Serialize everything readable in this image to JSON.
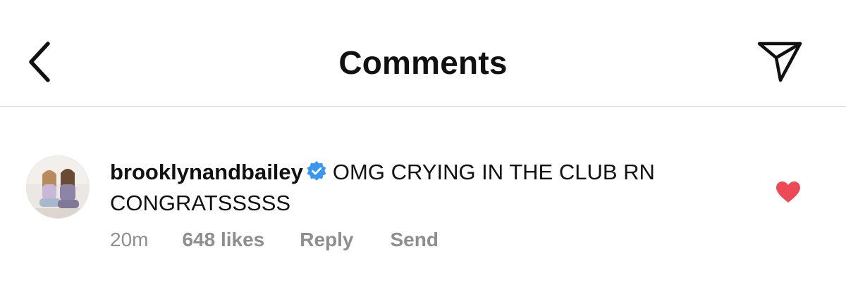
{
  "header": {
    "title": "Comments",
    "back_icon": "chevron-left-icon",
    "share_icon": "paper-plane-icon"
  },
  "comment": {
    "username": "brooklynandbailey",
    "verified": true,
    "verified_color": "#3897f0",
    "text": "OMG CRYING IN THE CLUB RN CONGRATSSSSS",
    "time": "20m",
    "likes": "648 likes",
    "reply_label": "Reply",
    "send_label": "Send",
    "liked": true,
    "heart_color": "#ed4956"
  }
}
